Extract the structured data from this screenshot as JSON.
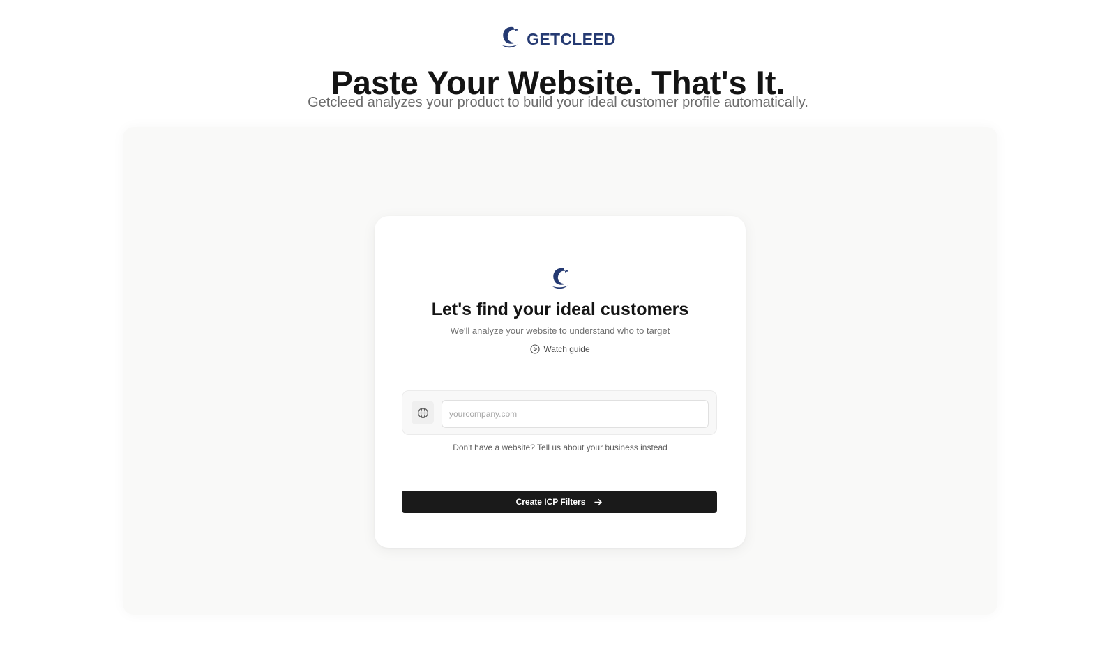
{
  "brand": {
    "name": "GETCLEED",
    "logo_icon": "getcleed-logo-icon",
    "color": "#253a72"
  },
  "hero": {
    "headline": "Paste Your Website. That's It.",
    "subheadline": "Getcleed analyzes your product to build your ideal customer profile automatically."
  },
  "card": {
    "title": "Let's find your ideal customers",
    "subtitle": "We'll analyze your website to understand who to target",
    "watch_guide": {
      "label": "Watch guide",
      "icon": "play-circle-icon"
    },
    "website_input": {
      "icon": "globe-icon",
      "placeholder": "yourcompany.com",
      "value": ""
    },
    "no_website_link": "Don't have a website? Tell us about your business instead",
    "submit_button": {
      "label": "Create ICP Filters",
      "icon": "arrow-right-icon",
      "color": "#1a1a1a"
    }
  }
}
